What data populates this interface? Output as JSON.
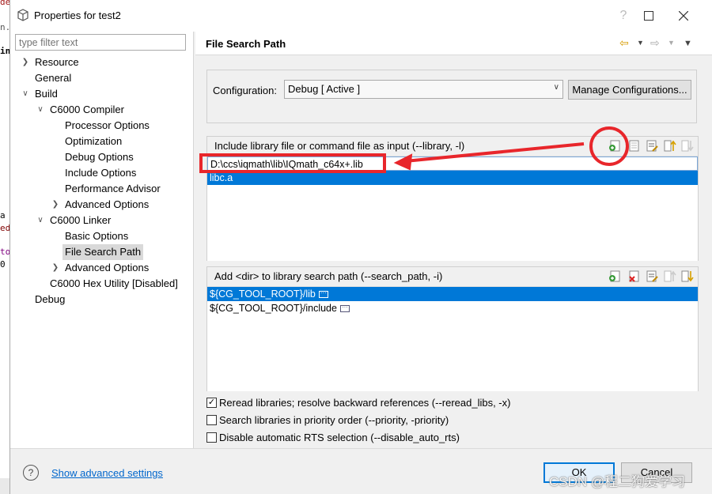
{
  "window": {
    "title": "Properties for test2"
  },
  "background_code": [
    "de \"stdio.h\"",
    "n.",
    "in",
    "a",
    "ed",
    "to",
    " 0"
  ],
  "filter": {
    "placeholder": "type filter text"
  },
  "tree": {
    "resource": "Resource",
    "general": "General",
    "build": "Build",
    "c6000_compiler": "C6000 Compiler",
    "processor_options": "Processor Options",
    "optimization": "Optimization",
    "debug_options": "Debug Options",
    "include_options": "Include Options",
    "performance_advisor": "Performance Advisor",
    "advanced_options": "Advanced Options",
    "c6000_linker": "C6000 Linker",
    "basic_options": "Basic Options",
    "file_search_path": "File Search Path",
    "linker_advanced_options": "Advanced Options",
    "hex_utility": "C6000 Hex Utility  [Disabled]",
    "debug": "Debug"
  },
  "page": {
    "title": "File Search Path",
    "configuration_label": "Configuration:",
    "configuration_value": "Debug  [ Active ]",
    "manage_button": "Manage Configurations..."
  },
  "library_group": {
    "label": "Include library file or command file as input (--library, -l)",
    "items": [
      "D:\\ccs\\iqmath\\lib\\IQmath_c64x+.lib",
      "libc.a"
    ]
  },
  "search_group": {
    "label": "Add <dir> to library search path (--search_path, -i)",
    "items": [
      "${CG_TOOL_ROOT}/lib",
      "${CG_TOOL_ROOT}/include"
    ]
  },
  "options": {
    "reread": "Reread libraries; resolve backward references (--reread_libs, -x)",
    "priority": "Search libraries in priority order (--priority, -priority)",
    "disable_rts": "Disable automatic RTS selection (--disable_auto_rts)"
  },
  "checked": {
    "reread": true,
    "priority": false,
    "disable_rts": false
  },
  "footer": {
    "advanced_link": "Show advanced settings",
    "ok": "OK",
    "cancel": "Cancel"
  },
  "watermark": "CSDN @程二狗爱学习",
  "colors": {
    "selection": "#0078d7",
    "annotation": "#e8262b",
    "link": "#0066cc"
  }
}
